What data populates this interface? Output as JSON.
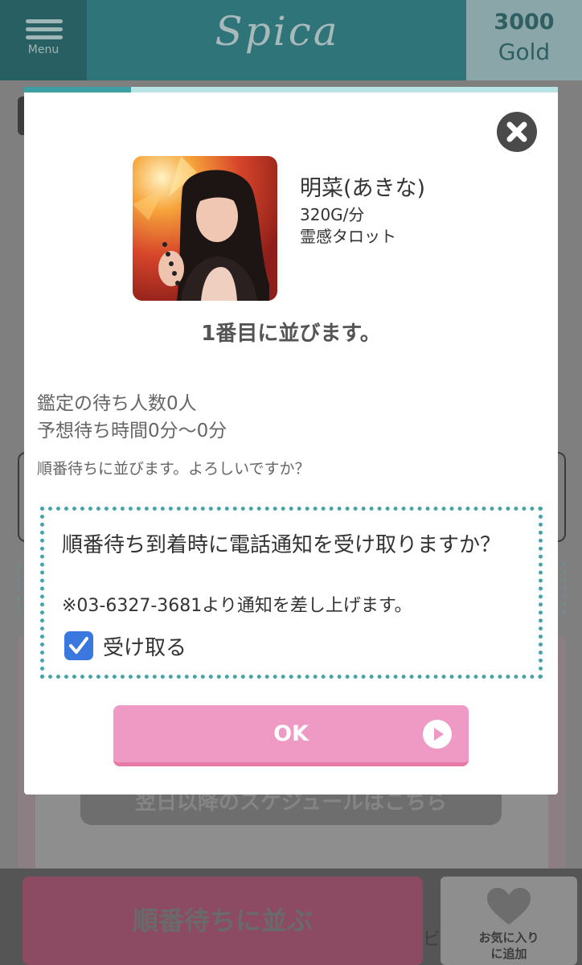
{
  "header": {
    "menu_label": "Menu",
    "logo": "Spica",
    "gold_amount": "3000",
    "gold_unit": "Gold"
  },
  "background": {
    "schedule_button": "翌日以降のスケジュールはこちら",
    "queue_button": "順番待ちに並ぶ",
    "peek_text": "ビ",
    "favorite_label": "お気に入り\nに追加"
  },
  "modal": {
    "progress_fraction": 0.2,
    "fortune_teller": {
      "name": "明菜(あきな)",
      "price": "320G/分",
      "genre": "霊感タロット"
    },
    "queue_position": "1番目に並びます。",
    "wait_count": "鑑定の待ち人数0人",
    "wait_time": "予想待ち時間0分〜0分",
    "confirm_question": "順番待ちに並びます。よろしいですか？",
    "notify": {
      "question": "順番待ち到着時に電話通知を受け取りますか？",
      "note": "※03-6327-3681より通知を差し上げます。",
      "checkbox_label": "受け取る",
      "checked": true
    },
    "ok_label": "OK"
  },
  "colors": {
    "header_teal": "#2f7478",
    "accent_teal": "#4aa3a6",
    "ok_pink": "#ef99c5",
    "checkbox_blue": "#3a78e0"
  }
}
